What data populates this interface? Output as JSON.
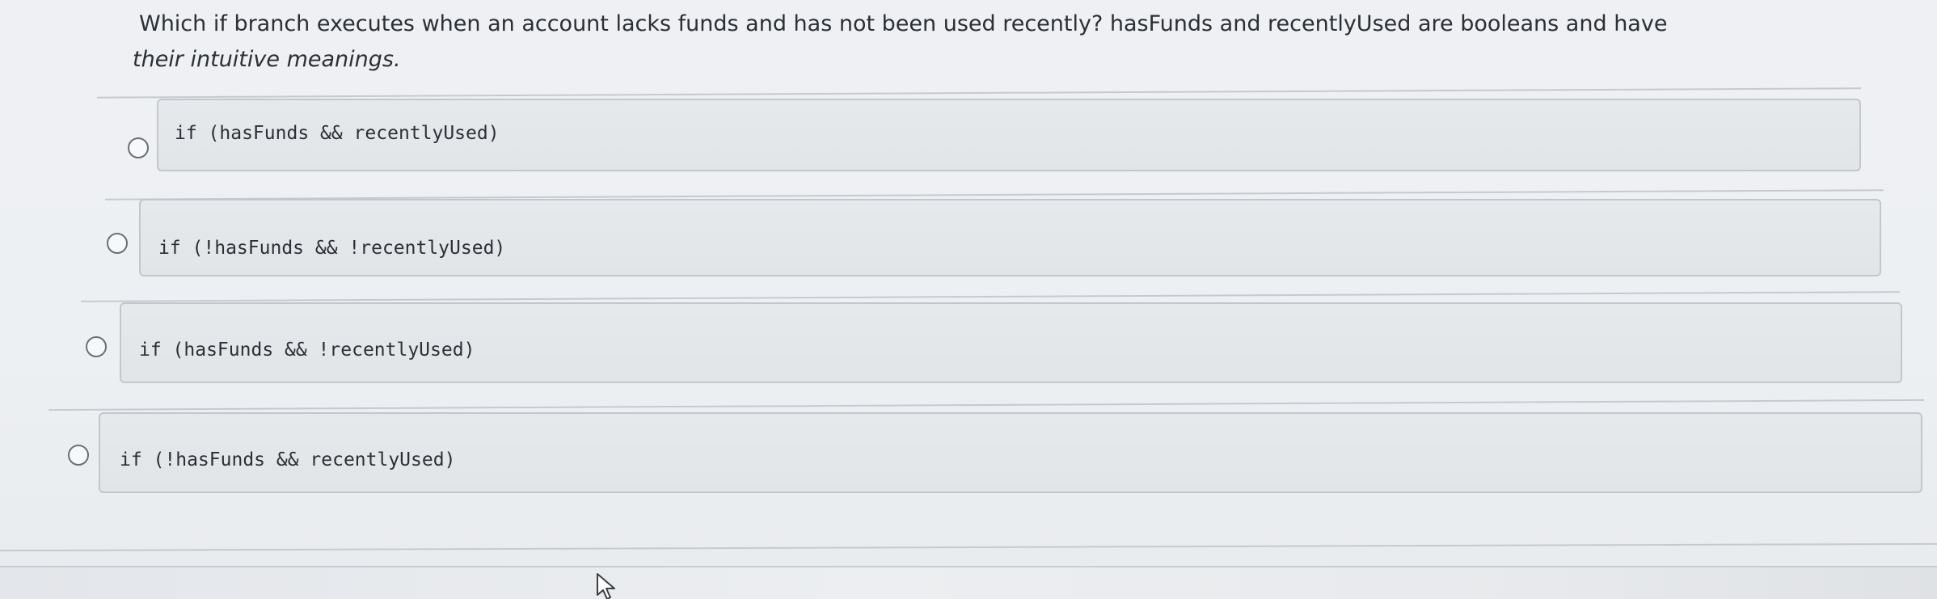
{
  "question": {
    "line1": "Which if branch executes when an account lacks funds and has not been used recently? hasFunds and recentlyUsed are booleans and have",
    "line2": "their intuitive meanings."
  },
  "options": [
    {
      "code": "if (hasFunds && recentlyUsed)"
    },
    {
      "code": "if (!hasFunds && !recentlyUsed)"
    },
    {
      "code": "if (hasFunds && !recentlyUsed)"
    },
    {
      "code": "if (!hasFunds && recentlyUsed)"
    }
  ],
  "icons": {
    "radio": "radio-button-empty",
    "cursor": "mouse-pointer-icon"
  },
  "colors": {
    "text": "#2c2f33",
    "box": "#e4e7ea",
    "border": "#c3c7cc"
  }
}
